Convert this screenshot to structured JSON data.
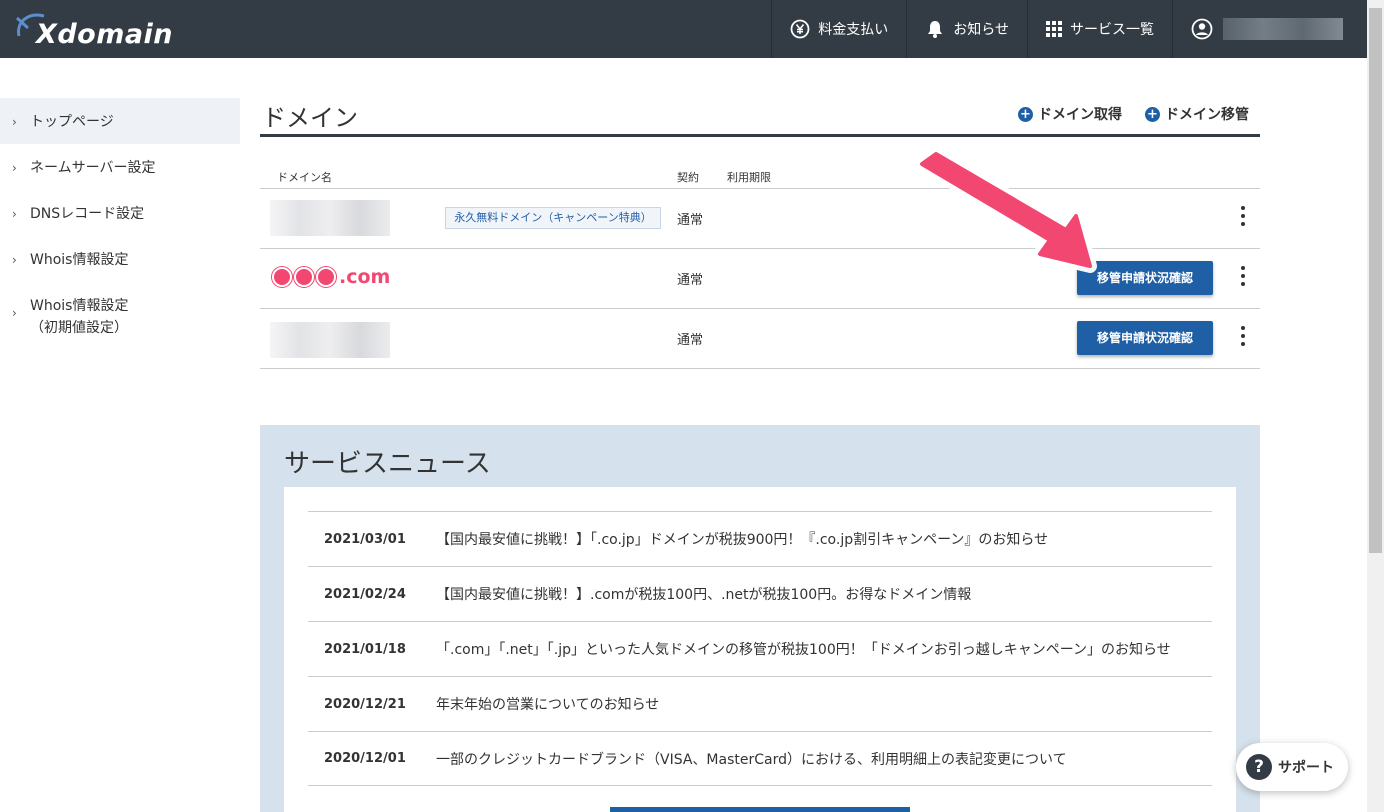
{
  "header": {
    "logo": "Xdomain",
    "nav": [
      {
        "label": "料金支払い",
        "icon": "yen-icon"
      },
      {
        "label": "お知らせ",
        "icon": "bell-icon"
      },
      {
        "label": "サービス一覧",
        "icon": "grid-icon"
      }
    ],
    "user_icon": "user-icon"
  },
  "sidebar": {
    "items": [
      {
        "label": "トップページ"
      },
      {
        "label": "ネームサーバー設定"
      },
      {
        "label": "DNSレコード設定"
      },
      {
        "label": "Whois情報設定"
      },
      {
        "label": "Whois情報設定",
        "sub": "（初期値設定）"
      }
    ]
  },
  "domain_section": {
    "title": "ドメイン",
    "add_domain": "ドメイン取得",
    "transfer_domain": "ドメイン移管",
    "columns": {
      "name": "ドメイン名",
      "contract": "契約",
      "expiry": "利用期限"
    },
    "rows": [
      {
        "badge": "永久無料ドメイン（キャンペーン特典）",
        "contract": "通常"
      },
      {
        "domain": ".com",
        "contract": "通常",
        "button": "移管申請状況確認"
      },
      {
        "contract": "通常",
        "button": "移管申請状況確認"
      }
    ]
  },
  "news": {
    "title": "サービスニュース",
    "items": [
      {
        "date": "2021/03/01",
        "text": "【国内最安値に挑戦！】「.co.jp」ドメインが税抜900円！『.co.jp割引キャンペーン』のお知らせ"
      },
      {
        "date": "2021/02/24",
        "text": "【国内最安値に挑戦！】.comが税抜100円、.netが税抜100円。お得なドメイン情報"
      },
      {
        "date": "2021/01/18",
        "text": "「.com」「.net」「.jp」といった人気ドメインの移管が税抜100円！「ドメインお引っ越しキャンペーン」のお知らせ"
      },
      {
        "date": "2020/12/21",
        "text": "年末年始の営業についてのお知らせ"
      },
      {
        "date": "2020/12/01",
        "text": "一部のクレジットカードブランド（VISA、MasterCard）における、利用明細上の表記変更について"
      }
    ]
  },
  "support": {
    "label": "サポート"
  },
  "colors": {
    "header": "#333b44",
    "primary": "#1f5fa6",
    "annotation": "#f24770",
    "news_bg": "#d5e1ec"
  }
}
